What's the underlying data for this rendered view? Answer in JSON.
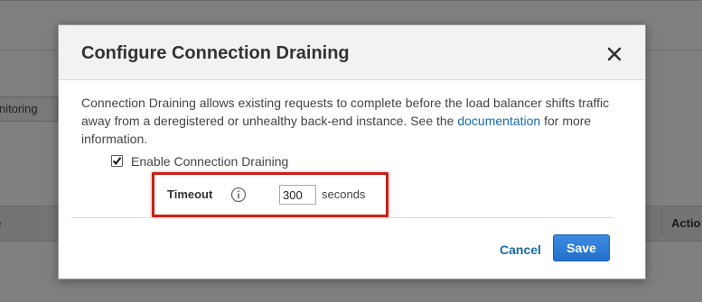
{
  "background": {
    "tab_label": "nitoring",
    "table_header_left": "ne",
    "table_header_right": "Actio"
  },
  "dialog": {
    "title": "Configure Connection Draining",
    "close_icon": "close-icon",
    "description": {
      "text_before_link": "Connection Draining allows existing requests to complete before the load balancer shifts traffic away from a deregistered or unhealthy back-end instance. See the ",
      "link_text": "documentation",
      "text_after_link": " for more information."
    },
    "enable_checkbox": {
      "label": "Enable Connection Draining",
      "checked": true
    },
    "timeout": {
      "label": "Timeout",
      "info_icon": "info-icon",
      "value": "300",
      "unit": "seconds"
    },
    "footer": {
      "cancel_label": "Cancel",
      "save_label": "Save"
    },
    "colors": {
      "primary_button": "#2370cc",
      "link": "#1a6aa8",
      "highlight_border": "#c5221a"
    }
  }
}
